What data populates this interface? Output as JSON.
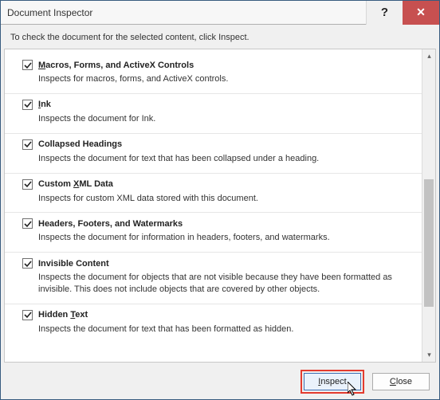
{
  "window": {
    "title": "Document Inspector",
    "help_glyph": "?",
    "close_glyph": "✕"
  },
  "instruction": "To check the document for the selected content, click Inspect.",
  "items": [
    {
      "label_pre": "",
      "label_ul": "M",
      "label_post": "acros, Forms, and ActiveX Controls",
      "desc": "Inspects for macros, forms, and ActiveX controls.",
      "checked": true
    },
    {
      "label_pre": "",
      "label_ul": "I",
      "label_post": "nk",
      "desc": "Inspects the document for Ink.",
      "checked": true
    },
    {
      "label_pre": "Collapsed Headings",
      "label_ul": "",
      "label_post": "",
      "desc": "Inspects the document for text that has been collapsed under a heading.",
      "checked": true
    },
    {
      "label_pre": "Custom ",
      "label_ul": "X",
      "label_post": "ML Data",
      "desc": "Inspects for custom XML data stored with this document.",
      "checked": true
    },
    {
      "label_pre": "Headers, Footers, and Watermarks",
      "label_ul": "",
      "label_post": "",
      "desc": "Inspects the document for information in headers, footers, and watermarks.",
      "checked": true
    },
    {
      "label_pre": "Invisible Content",
      "label_ul": "",
      "label_post": "",
      "desc": "Inspects the document for objects that are not visible because they have been formatted as invisible. This does not include objects that are covered by other objects.",
      "checked": true
    },
    {
      "label_pre": "Hidden ",
      "label_ul": "T",
      "label_post": "ext",
      "desc": "Inspects the document for text that has been formatted as hidden.",
      "checked": true
    }
  ],
  "buttons": {
    "inspect_ul": "I",
    "inspect_post": "nspect",
    "close_ul": "C",
    "close_post": "lose"
  },
  "scroll": {
    "up_glyph": "▴",
    "down_glyph": "▾"
  }
}
